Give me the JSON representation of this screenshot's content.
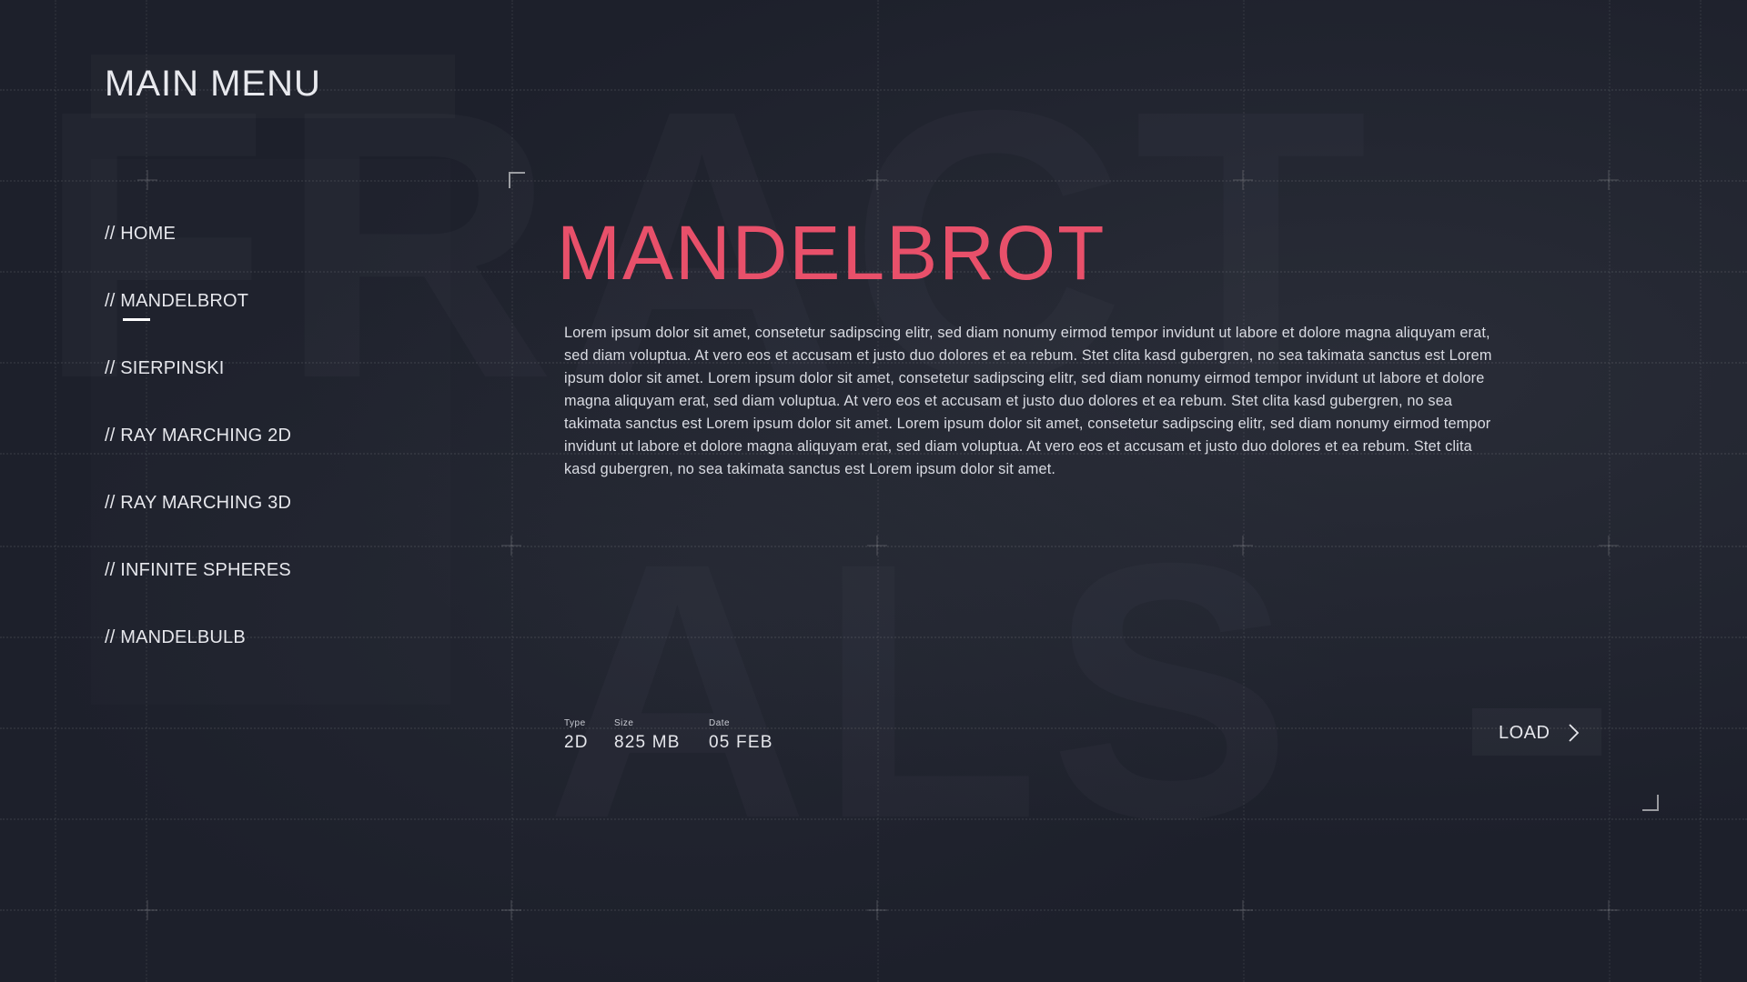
{
  "header": {
    "title": "MAIN MENU"
  },
  "background": {
    "watermark_line1": "FRACT",
    "watermark_line2": "ALS"
  },
  "sidebar": {
    "items": [
      {
        "label": "// HOME",
        "active": false
      },
      {
        "label": "// MANDELBROT",
        "active": true
      },
      {
        "label": "// SIERPINSKI",
        "active": false
      },
      {
        "label": "// RAY MARCHING 2D",
        "active": false
      },
      {
        "label": "// RAY MARCHING 3D",
        "active": false
      },
      {
        "label": "// INFINITE SPHERES",
        "active": false
      },
      {
        "label": "// MANDELBULB",
        "active": false
      }
    ]
  },
  "content": {
    "title": "MANDELBROT",
    "description": "Lorem ipsum dolor sit amet, consetetur sadipscing elitr, sed diam nonumy eirmod tempor invidunt ut labore et dolore magna aliquyam erat, sed diam voluptua. At vero eos et accusam et justo duo dolores et ea rebum. Stet clita kasd gubergren, no sea takimata sanctus est Lorem ipsum dolor sit amet. Lorem ipsum dolor sit amet, consetetur sadipscing elitr, sed diam nonumy eirmod tempor invidunt ut labore et dolore magna aliquyam erat, sed diam voluptua. At vero eos et accusam et justo duo dolores et ea rebum. Stet clita kasd gubergren, no sea takimata sanctus est Lorem ipsum dolor sit amet. Lorem ipsum dolor sit amet, consetetur sadipscing elitr, sed diam nonumy eirmod tempor invidunt ut labore et dolore magna aliquyam erat, sed diam voluptua. At vero eos et accusam et justo duo dolores et ea rebum. Stet clita kasd gubergren, no sea takimata sanctus est Lorem ipsum dolor sit amet.",
    "meta": {
      "type_label": "Type",
      "type_value": "2D",
      "size_label": "Size",
      "size_value": "825 MB",
      "date_label": "Date",
      "date_value": "05 FEB"
    },
    "load_label": "LOAD",
    "load_icon": "chevron-right-icon"
  },
  "colors": {
    "background": "#1d202b",
    "accent": "#e8506a",
    "text": "#e6e7ec"
  }
}
